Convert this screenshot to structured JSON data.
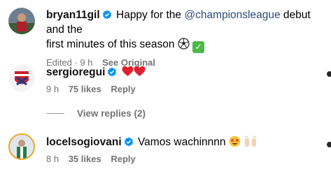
{
  "comments": [
    {
      "username": "bryan11gil",
      "text_before": "Happy for the ",
      "mention": "@championsleague",
      "text_after": " debut and the",
      "text_line2": "first minutes of this season",
      "emojis": [
        "soccer-ball",
        "check-mark-button"
      ],
      "meta": {
        "edited": "Edited · 9 h",
        "see_original": "See Original"
      }
    },
    {
      "username": "sergioregui",
      "text": "",
      "emojis": [
        "red-heart",
        "red-heart"
      ],
      "meta": {
        "time": "9 h",
        "likes": "75 likes",
        "reply": "Reply"
      }
    },
    {
      "username": "locelsogiovani",
      "text": "Vamos wachinnnn",
      "emojis": [
        "star-struck",
        "raising-hands"
      ],
      "meta": {
        "time": "8 h",
        "likes": "35 likes",
        "reply": "Reply"
      }
    }
  ],
  "view_replies": "View replies (2)",
  "colors": {
    "verified": "#0095f6",
    "meta": "#737373",
    "mention": "#2a4a7a"
  }
}
